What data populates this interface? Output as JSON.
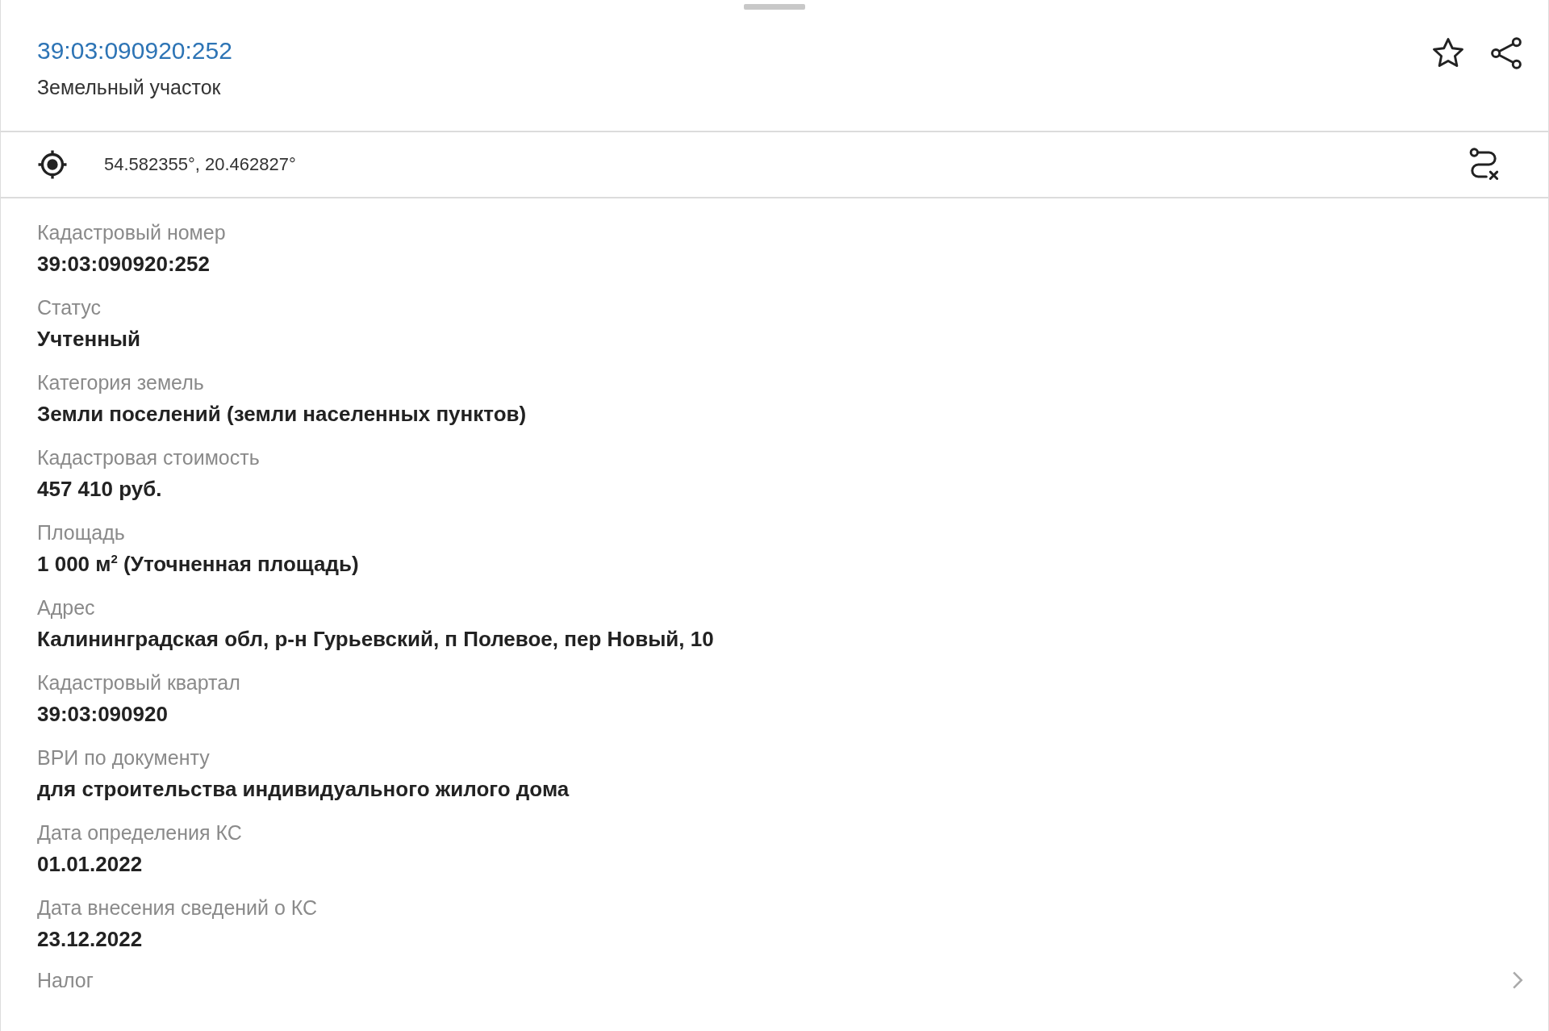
{
  "header": {
    "title": "39:03:090920:252",
    "subtitle": "Земельный участок"
  },
  "coordinates": {
    "text": "54.582355°, 20.462827°"
  },
  "fields": [
    {
      "label": "Кадастровый номер",
      "value": "39:03:090920:252"
    },
    {
      "label": "Статус",
      "value": "Учтенный"
    },
    {
      "label": "Категория земель",
      "value": "Земли поселений (земли населенных пунктов)"
    },
    {
      "label": "Кадастровая стоимость",
      "value": "457 410 руб."
    },
    {
      "label": "Площадь",
      "value": "1 000 м$^{2}$ (Уточненная площадь)"
    },
    {
      "label": "Адрес",
      "value": "Калининградская обл, р-н Гурьевский, п Полевое, пер Новый, 10"
    },
    {
      "label": "Кадастровый квартал",
      "value": "39:03:090920"
    },
    {
      "label": "ВРИ по документу",
      "value": "для строительства индивидуального жилого дома"
    },
    {
      "label": "Дата определения КС",
      "value": "01.01.2022"
    },
    {
      "label": "Дата внесения сведений о КС",
      "value": "23.12.2022"
    }
  ],
  "tax_row": {
    "label": "Налог"
  }
}
